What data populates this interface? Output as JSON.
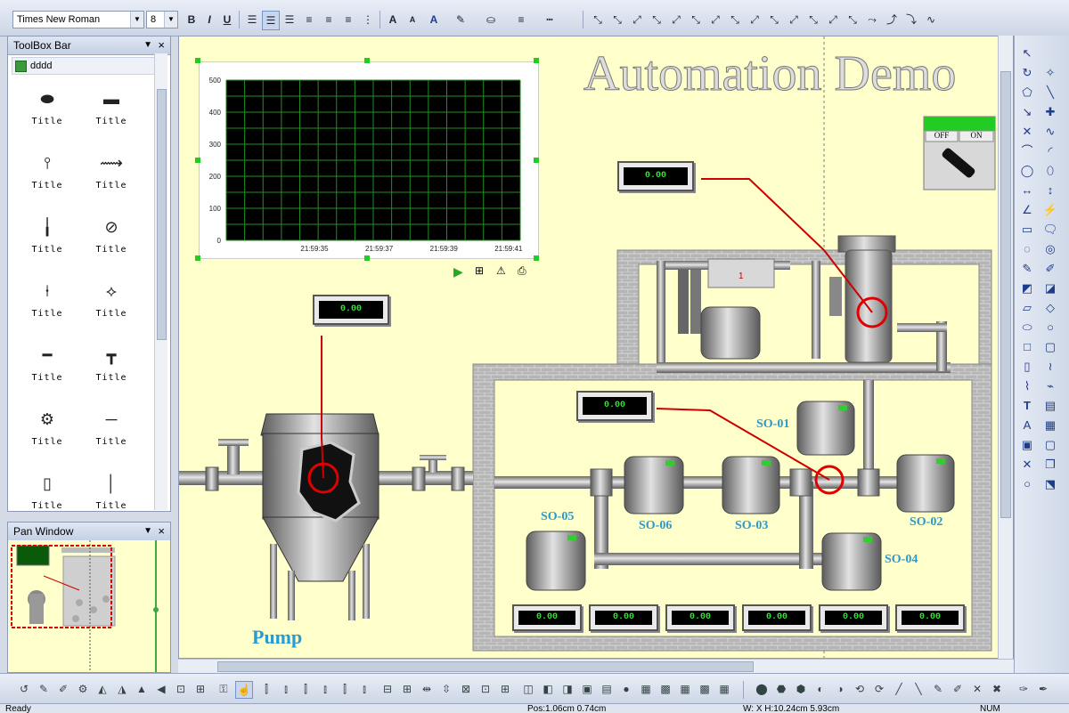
{
  "toolbar": {
    "font_name": "Times New Roman",
    "font_size": "8",
    "bold": "B",
    "italic": "I",
    "underline": "U"
  },
  "toolbox": {
    "title": "ToolBox Bar",
    "pin": "▼",
    "close": "×",
    "category": "dddd",
    "items": [
      "Title",
      "Title",
      "Title",
      "Title",
      "Title",
      "Title",
      "Title",
      "Title",
      "Title",
      "Title",
      "Title",
      "Title",
      "Title",
      "Title"
    ]
  },
  "pan_window": {
    "title": "Pan Window",
    "pin": "▼",
    "close": "×"
  },
  "canvas": {
    "heading": "Automation Demo",
    "switch": {
      "off_label": "OFF",
      "on_label": "ON"
    },
    "pump_label": "Pump",
    "display_value": "0.00",
    "motor_tags": [
      "SO-01",
      "SO-02",
      "SO-03",
      "SO-04",
      "SO-05",
      "SO-06"
    ]
  },
  "chart_data": {
    "type": "line",
    "title": "",
    "xlabel": "",
    "ylabel": "",
    "x_ticks": [
      "21:59:35",
      "21:59:37",
      "21:59:39",
      "21:59:41"
    ],
    "y_ticks": [
      0,
      100,
      200,
      300,
      400,
      500
    ],
    "ylim": [
      0,
      500
    ],
    "grid": true,
    "background": "#000000",
    "grid_color": "#1f8f1f",
    "series": []
  },
  "status": {
    "ready": "Ready",
    "pos": "Pos:1.06cm 0.74cm",
    "size": "W: X H:10.24cm 5.93cm",
    "num": "NUM"
  },
  "colors": {
    "canvas_bg": "#ffffcc",
    "display_text": "#2ee82e",
    "tag_text": "#2a9ad0",
    "connector": "#cc0000",
    "switch_bar": "#22cc22"
  }
}
